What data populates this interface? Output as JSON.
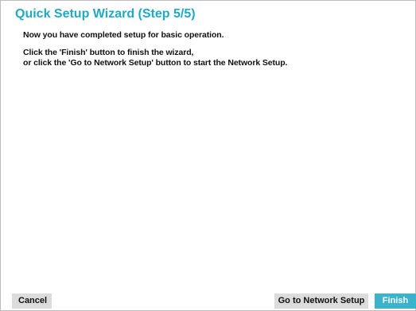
{
  "dialog": {
    "title": "Quick Setup Wizard (Step 5/5)",
    "message_line1": "Now you have completed setup for basic operation.",
    "message_line2": "Click the 'Finish' button to finish the wizard,",
    "message_line3": "or click the 'Go to Network Setup' button to start the Network Setup."
  },
  "buttons": {
    "cancel_label": "Cancel",
    "network_label": "Go to Network Setup",
    "finish_label": "Finish"
  },
  "colors": {
    "accent": "#1fa9c4",
    "finish_bg": "#3cb3cc",
    "button_bg": "#dcdcdc"
  }
}
